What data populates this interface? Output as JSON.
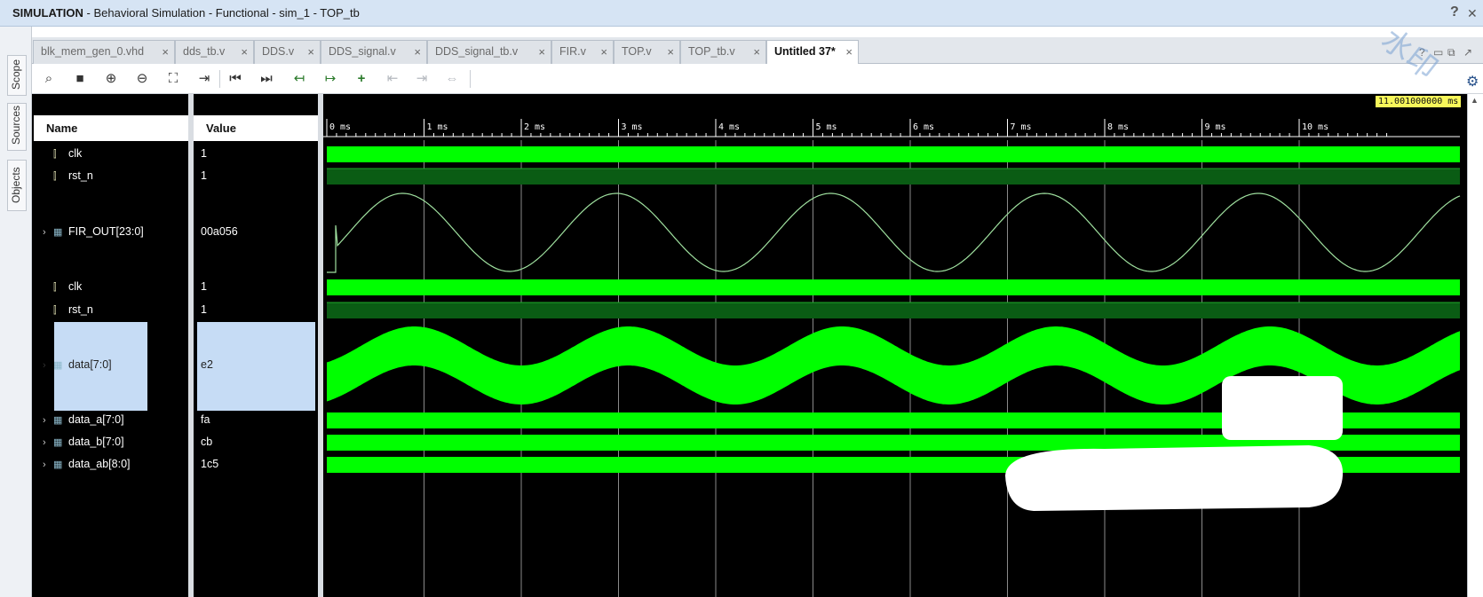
{
  "title": {
    "mode": "SIMULATION",
    "rest": " - Behavioral Simulation - Functional - sim_1 - TOP_tb",
    "help": "?",
    "close": "✕"
  },
  "side_tabs": [
    "Scope",
    "Sources",
    "Objects"
  ],
  "tabs": [
    {
      "label": "blk_mem_gen_0.vhd"
    },
    {
      "label": "dds_tb.v"
    },
    {
      "label": "DDS.v"
    },
    {
      "label": "DDS_signal.v"
    },
    {
      "label": "DDS_signal_tb.v"
    },
    {
      "label": "FIR.v"
    },
    {
      "label": "TOP.v"
    },
    {
      "label": "TOP_tb.v"
    },
    {
      "label": "Untitled 37*",
      "active": true
    }
  ],
  "tab_close": "×",
  "window_controls": [
    "?",
    "▭",
    "⧉",
    "↗"
  ],
  "toolbar": [
    {
      "name": "search-icon",
      "glyph": "⌕"
    },
    {
      "name": "save-icon",
      "glyph": "■"
    },
    {
      "name": "zoom-in-icon",
      "glyph": "⊕"
    },
    {
      "name": "zoom-out-icon",
      "glyph": "⊖"
    },
    {
      "name": "zoom-fit-icon",
      "glyph": "⛶"
    },
    {
      "name": "go-to-cursor-icon",
      "glyph": "⇥"
    },
    {
      "name": "go-to-start-icon",
      "glyph": "⏮"
    },
    {
      "name": "go-to-end-icon",
      "glyph": "⏭"
    },
    {
      "name": "previous-transition-icon",
      "glyph": "↤"
    },
    {
      "name": "next-transition-icon",
      "glyph": "↦"
    },
    {
      "name": "add-marker-icon",
      "glyph": "+"
    },
    {
      "name": "previous-marker-icon",
      "glyph": "⇤",
      "disabled": true
    },
    {
      "name": "next-marker-icon",
      "glyph": "⇥",
      "disabled": true
    },
    {
      "name": "swap-cursors-icon",
      "glyph": "⇔",
      "disabled": true
    }
  ],
  "columns": {
    "name": "Name",
    "value": "Value"
  },
  "cursor_time": "11.001000000 ms",
  "time_ticks": [
    "0 ms",
    "1 ms",
    "2 ms",
    "3 ms",
    "4 ms",
    "5 ms",
    "6 ms",
    "7 ms",
    "8 ms",
    "9 ms",
    "10 ms"
  ],
  "signals": [
    {
      "name": "clk",
      "value": "1",
      "type": "bit",
      "wave": "clock"
    },
    {
      "name": "rst_n",
      "value": "1",
      "type": "bit",
      "wave": "high"
    },
    {
      "name": "FIR_OUT[23:0]",
      "value": "00a056",
      "type": "bus",
      "expand": true,
      "wave": "analog"
    },
    {
      "name": "clk",
      "value": "1",
      "type": "bit",
      "wave": "clock"
    },
    {
      "name": "rst_n",
      "value": "1",
      "type": "bit",
      "wave": "high"
    },
    {
      "name": "data[7:0]",
      "value": "e2",
      "type": "bus",
      "expand": true,
      "selected": true,
      "wave": "band"
    },
    {
      "name": "data_a[7:0]",
      "value": "fa",
      "type": "bus",
      "expand": true,
      "wave": "bus"
    },
    {
      "name": "data_b[7:0]",
      "value": "cb",
      "type": "bus",
      "expand": true,
      "wave": "bus"
    },
    {
      "name": "data_ab[8:0]",
      "value": "1c5",
      "type": "bus",
      "expand": true,
      "wave": "bus"
    }
  ],
  "colors": {
    "wave_green": "#00ff00",
    "dark_green": "#0a5c14",
    "analog_line": "#9fe09f",
    "grid": "#8a8a8a",
    "cursor_bg": "#f7f75a"
  },
  "watermark": "水印"
}
